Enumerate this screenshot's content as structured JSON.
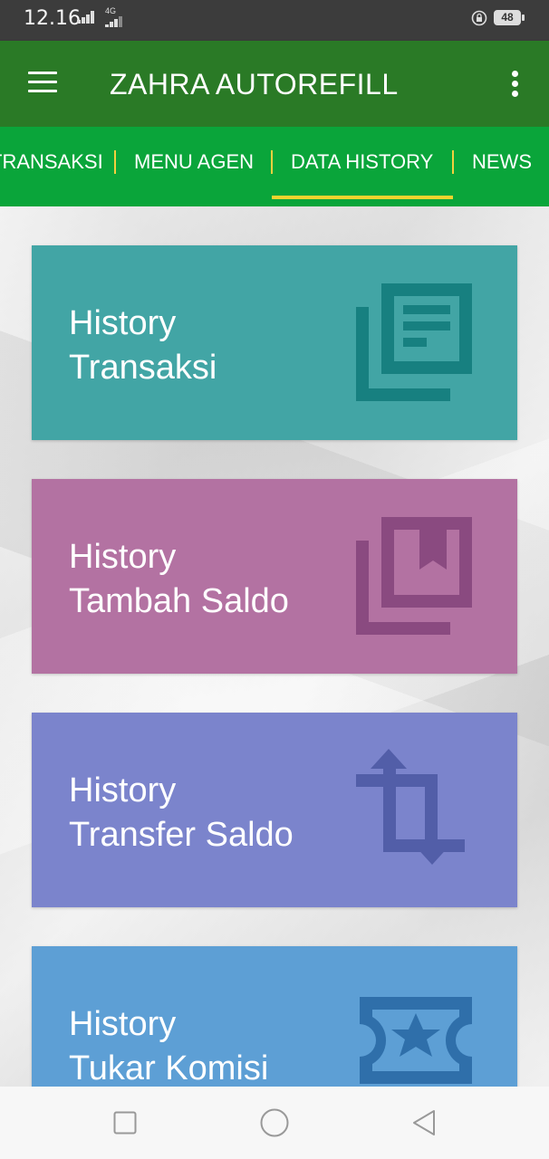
{
  "status_bar": {
    "time": "12.16",
    "network_type": "4G",
    "battery_level": "48"
  },
  "app_bar": {
    "title": "ZAHRA AUTOREFILL",
    "menu_icon": "hamburger-icon",
    "overflow_icon": "more-vert-icon"
  },
  "tabs": [
    {
      "label": "TRANSAKSI",
      "selected": false
    },
    {
      "label": "MENU AGEN",
      "selected": false
    },
    {
      "label": "DATA HISTORY",
      "selected": true
    },
    {
      "label": "NEWS",
      "selected": false
    }
  ],
  "tab_colors": {
    "bar": "#0aa53a",
    "indicator": "#f3d42d",
    "separator": "#f4d03f"
  },
  "cards": [
    {
      "line1": "History",
      "line2": "Transaksi",
      "icon": "news-icon",
      "color": "#42a5a5",
      "icon_color": "#178080"
    },
    {
      "line1": "History",
      "line2": "Tambah Saldo",
      "icon": "library-books-icon",
      "color": "#b372a2",
      "icon_color": "#8a4a80"
    },
    {
      "line1": "History",
      "line2": "Transfer Saldo",
      "icon": "crop-rotate-icon",
      "color": "#7b84cc",
      "icon_color": "#525ea8"
    },
    {
      "line1": "History",
      "line2": "Tukar Komisi",
      "icon": "ticket-star-icon",
      "color": "#5d9fd5",
      "icon_color": "#2f6faa"
    }
  ],
  "nav_bar": {
    "buttons": [
      "recent-apps-button",
      "home-button",
      "back-button"
    ]
  }
}
